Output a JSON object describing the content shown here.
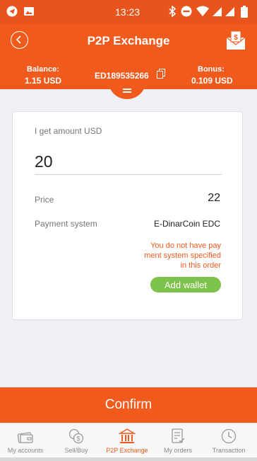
{
  "status_bar": {
    "time": "13:23"
  },
  "header": {
    "title": "P2P Exchange",
    "balance_label": "Balance:",
    "balance_value": "1.15 USD",
    "account_id": "ED189535266",
    "bonus_label": "Bonus:",
    "bonus_value": "0.109 USD"
  },
  "form": {
    "amount_label": "I get amount USD",
    "amount_value": "20",
    "price_label": "Price",
    "price_value": "22",
    "payment_system_label": "Payment system",
    "payment_system_value": "E-DinarCoin EDC",
    "warning_lines": [
      "You do not have pay",
      "ment system specified",
      "in this order"
    ],
    "add_wallet_label": "Add wallet"
  },
  "confirm_label": "Confirm",
  "nav": [
    {
      "label": "My accounts",
      "icon": "wallet-icon",
      "active": false
    },
    {
      "label": "Sell/Buy",
      "icon": "coins-icon",
      "active": false
    },
    {
      "label": "P2P Exchange",
      "icon": "bank-icon",
      "active": true
    },
    {
      "label": "My orders",
      "icon": "orders-icon",
      "active": false
    },
    {
      "label": "Transaction",
      "icon": "clock-icon",
      "active": false
    }
  ],
  "colors": {
    "accent": "#f05b1d",
    "status_bar": "#e9531c",
    "wallet_button": "#7dc24b",
    "warning": "#f15a1f"
  }
}
